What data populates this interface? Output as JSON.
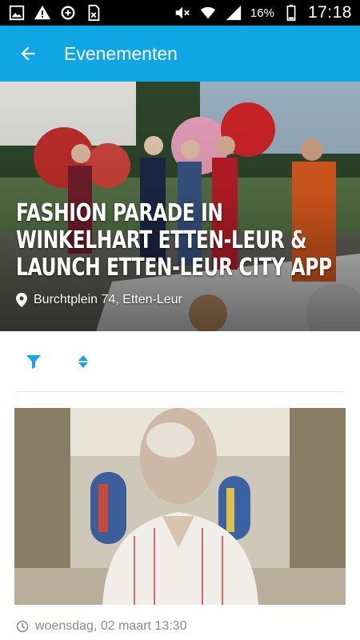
{
  "status_bar": {
    "left_icons": [
      "image-icon",
      "warning-icon",
      "data-saver-icon",
      "sim-card-off-icon"
    ],
    "right_icons": [
      "mute-icon",
      "wifi-icon",
      "signal-icon",
      "battery-icon"
    ],
    "battery": "16%",
    "time": "17:18"
  },
  "app_bar": {
    "title": "Evenementen",
    "back_icon": "arrow-left-icon"
  },
  "featured": {
    "title": "Fashion parade in Winkelhart Etten-Leur & launch Etten-Leur City App",
    "location": "Burchtplein 74, Etten-Leur",
    "location_icon": "map-pin-icon"
  },
  "toolbar": {
    "filter_icon": "filter-icon",
    "sort_icon": "sort-icon"
  },
  "events": [
    {
      "date": "woensdag, 02 maart 13:30",
      "date_icon": "clock-icon"
    }
  ],
  "colors": {
    "primary": "#10a5e4",
    "status_bar": "#000000",
    "muted_text": "#8c8c8c",
    "divider": "#e3e3e3"
  }
}
